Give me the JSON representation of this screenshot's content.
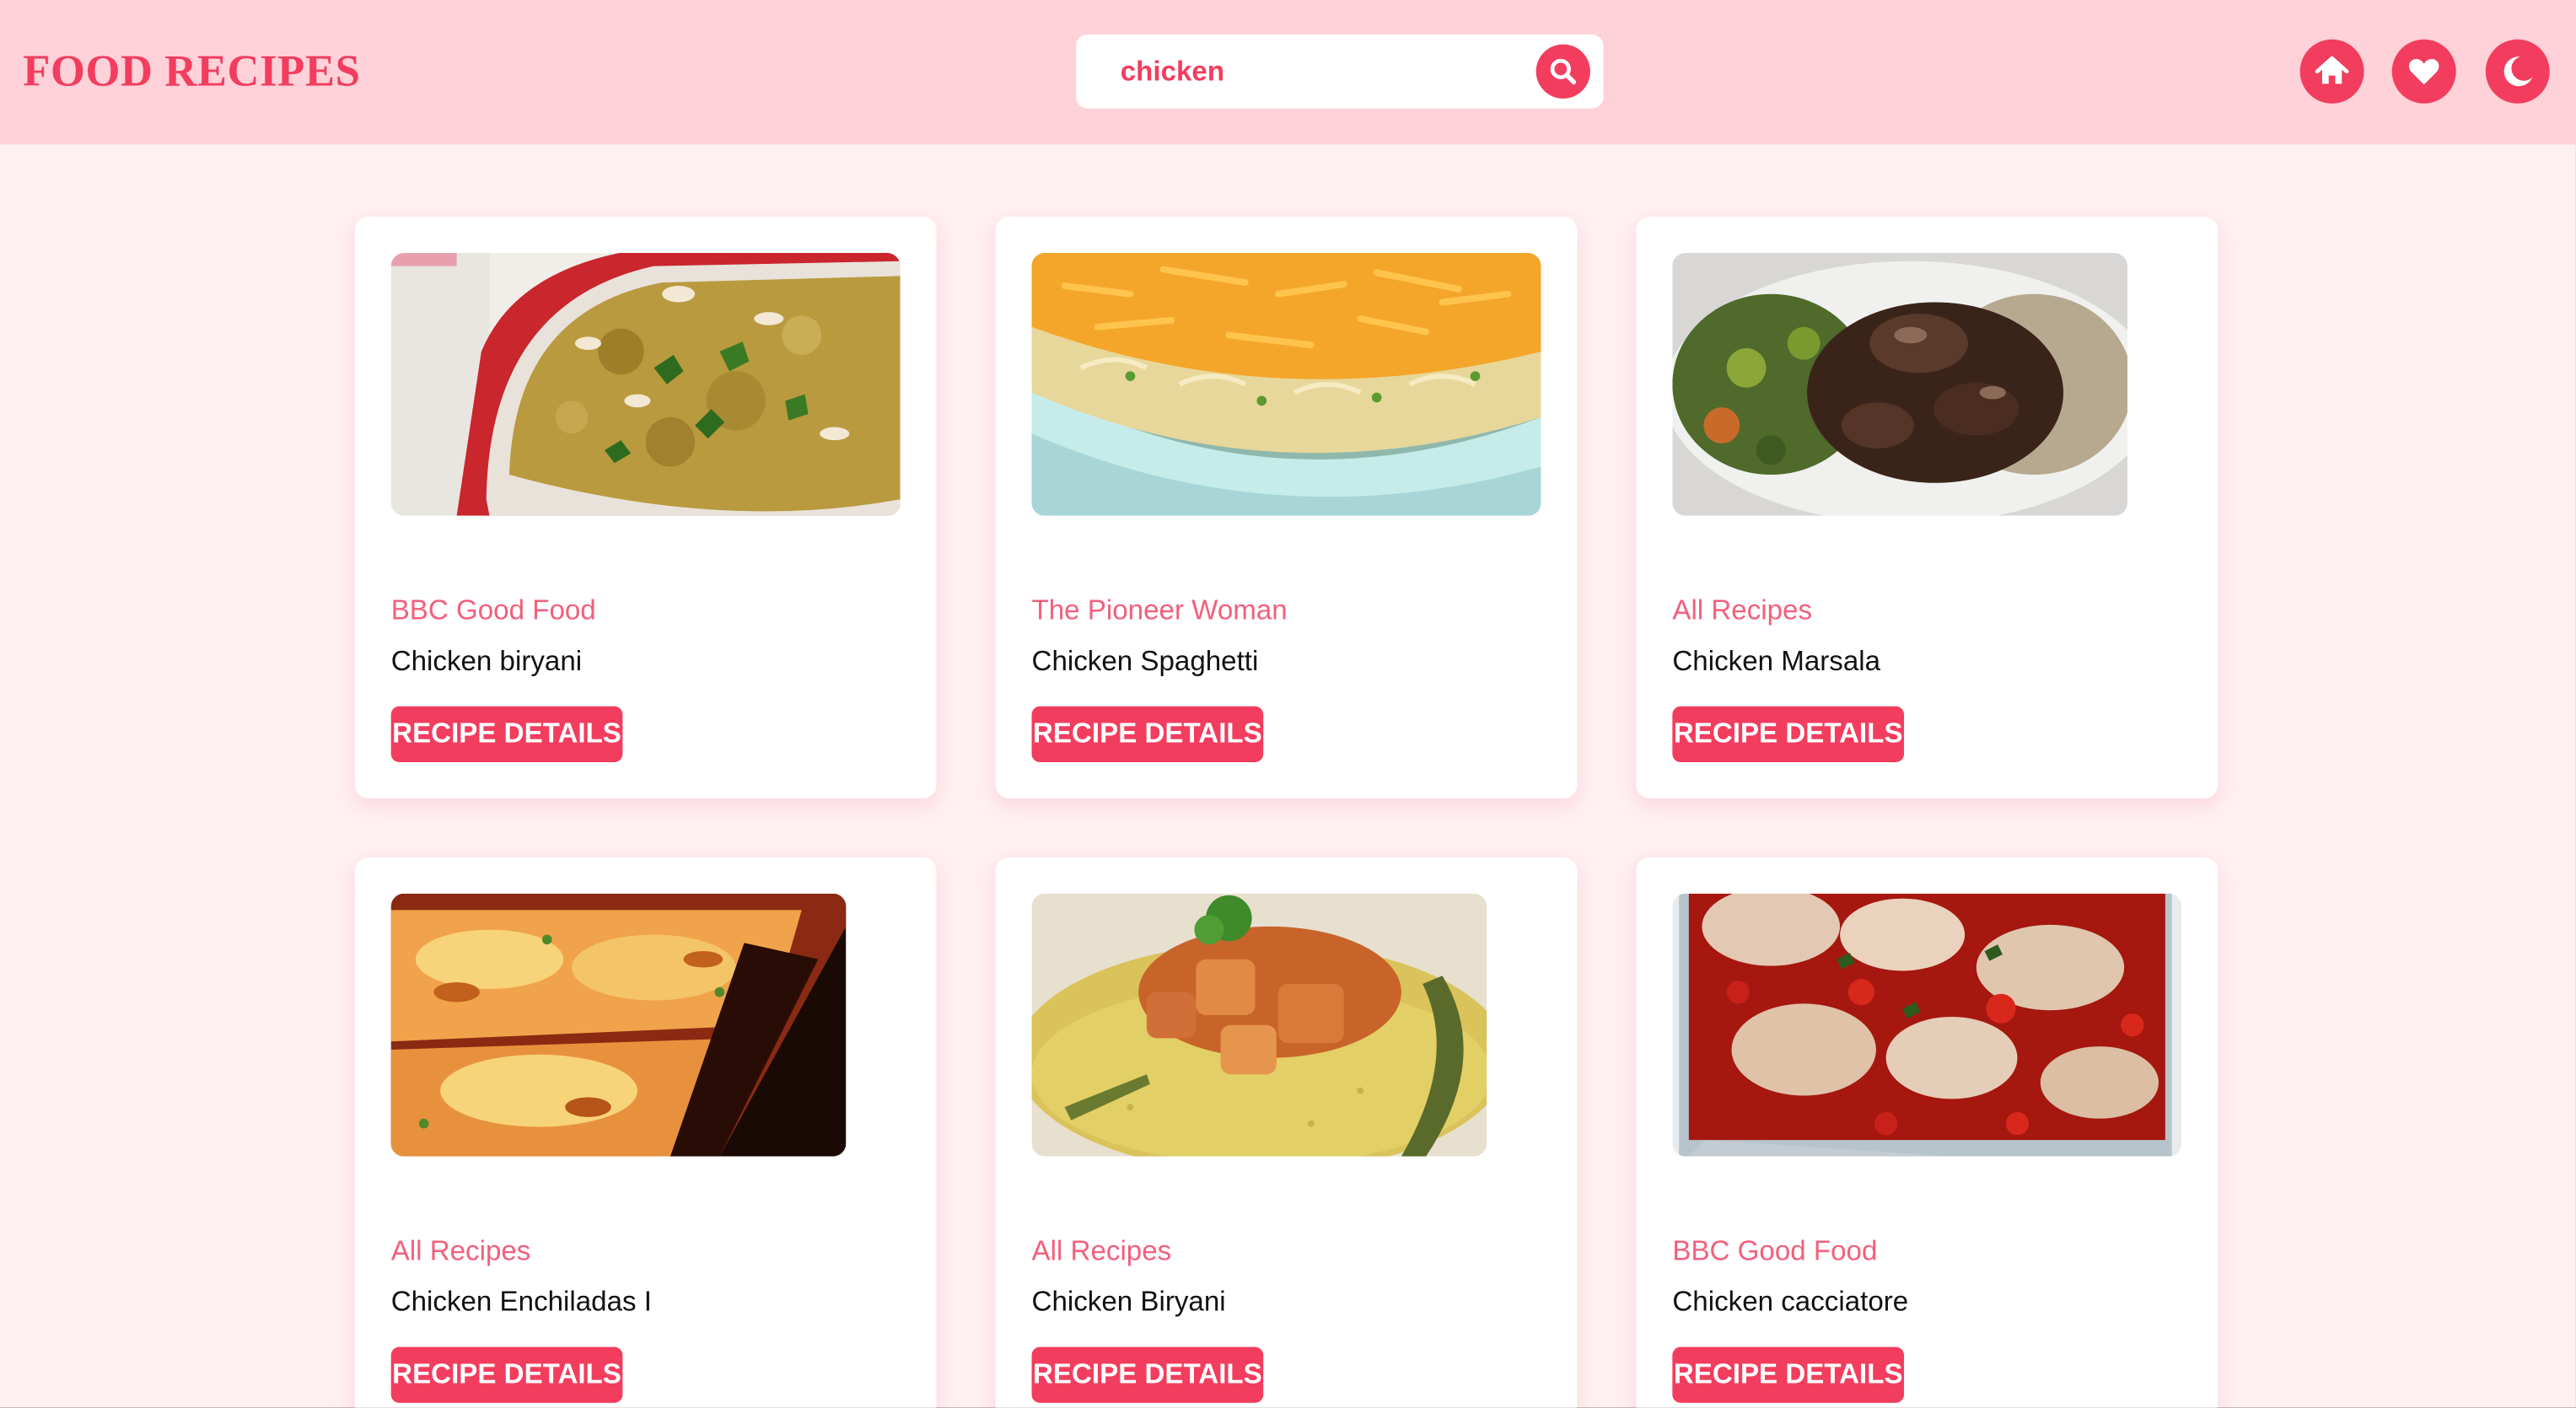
{
  "header": {
    "logo": "FOOD RECIPES",
    "search_value": "chicken",
    "search_icon": "search-icon",
    "nav_icons": [
      "home-icon",
      "heart-icon",
      "moon-icon"
    ]
  },
  "colors": {
    "accent": "#f23d5e",
    "header_bg": "#ffd1d9",
    "page_bg": "#fff0f2",
    "source_text": "#f2607c"
  },
  "recipes": [
    {
      "source": "BBC Good Food",
      "title": "Chicken biryani",
      "button": "RECIPE DETAILS"
    },
    {
      "source": "The Pioneer Woman",
      "title": "Chicken Spaghetti",
      "button": "RECIPE DETAILS"
    },
    {
      "source": "All Recipes",
      "title": "Chicken Marsala",
      "button": "RECIPE DETAILS"
    },
    {
      "source": "All Recipes",
      "title": "Chicken Enchiladas I",
      "button": "RECIPE DETAILS"
    },
    {
      "source": "All Recipes",
      "title": "Chicken Biryani",
      "button": "RECIPE DETAILS"
    },
    {
      "source": "BBC Good Food",
      "title": "Chicken cacciatore",
      "button": "RECIPE DETAILS"
    }
  ]
}
